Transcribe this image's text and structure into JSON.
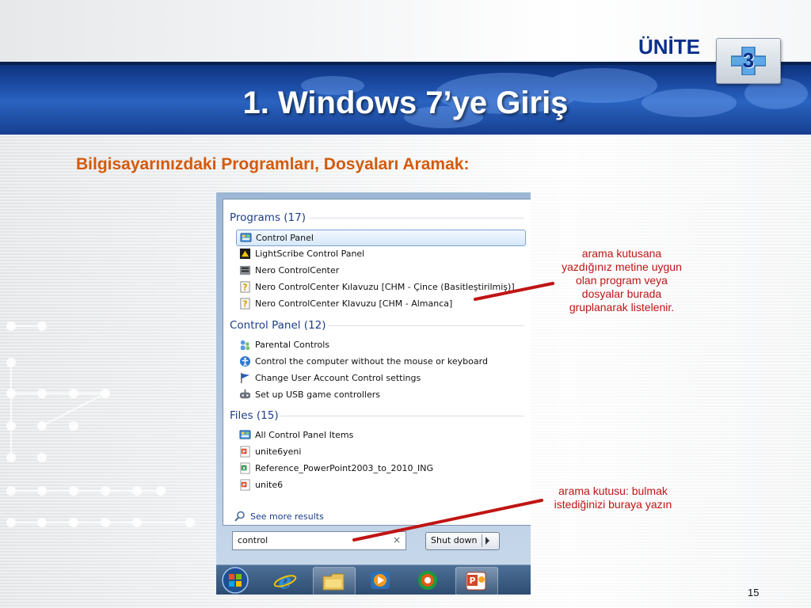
{
  "slide": {
    "unit_label": "ÜNİTE",
    "unit_number": "3",
    "title": "1. Windows 7’ye Giriş",
    "subtitle": "Bilgisayarınızdaki Programları, Dosyaları Aramak:",
    "page_number": "15",
    "colors": {
      "title_band": "#1d4ea8",
      "subtitle": "#d45a0c",
      "callout": "#c01414",
      "unit": "#0b2f8c"
    }
  },
  "start_menu": {
    "groups": [
      {
        "title": "Programs (17)",
        "items": [
          {
            "label": "Control Panel",
            "icon": "control-panel-icon",
            "selected": true
          },
          {
            "label": "LightScribe Control Panel",
            "icon": "lightscribe-icon",
            "selected": false
          },
          {
            "label": "Nero ControlCenter",
            "icon": "nero-icon",
            "selected": false
          },
          {
            "label": "Nero ControlCenter Kılavuzu [CHM - Çince (Basitleştirilmiş)]",
            "icon": "help-file-icon",
            "selected": false
          },
          {
            "label": "Nero ControlCenter Klavuzu [CHM - Almanca]",
            "icon": "help-file-icon",
            "selected": false
          }
        ]
      },
      {
        "title": "Control Panel (12)",
        "items": [
          {
            "label": "Parental Controls",
            "icon": "parental-controls-icon",
            "selected": false
          },
          {
            "label": "Control the computer without the mouse or keyboard",
            "icon": "ease-of-access-icon",
            "selected": false
          },
          {
            "label": "Change User Account Control settings",
            "icon": "uac-flag-icon",
            "selected": false
          },
          {
            "label": "Set up USB game controllers",
            "icon": "game-controller-icon",
            "selected": false
          }
        ]
      },
      {
        "title": "Files (15)",
        "items": [
          {
            "label": "All Control Panel Items",
            "icon": "control-panel-icon",
            "selected": false
          },
          {
            "label": "unite6yeni",
            "icon": "powerpoint-file-icon",
            "selected": false
          },
          {
            "label": "Reference_PowerPoint2003_to_2010_ING",
            "icon": "excel-file-icon",
            "selected": false
          },
          {
            "label": "unite6",
            "icon": "powerpoint-file-icon",
            "selected": false
          }
        ]
      }
    ],
    "see_more": "See more results",
    "search_value": "control",
    "clear_glyph": "×",
    "shutdown_label": "Shut down"
  },
  "taskbar": {
    "items": [
      "start-orb-icon",
      "internet-explorer-icon",
      "windows-explorer-icon",
      "media-player-icon",
      "media-center-icon",
      "powerpoint-icon"
    ]
  },
  "callouts": {
    "results_note": "arama kutusana yazdığınız metine uygun olan program veya dosyalar burada gruplanarak listelenir.",
    "results_note_lines": [
      "arama kutusana",
      "yazdığınız metine uygun",
      "olan program veya",
      "dosyalar burada",
      "gruplanarak listelenir."
    ],
    "search_note_lines": [
      "arama kutusu: bulmak",
      "istediğinizi buraya yazın"
    ]
  }
}
